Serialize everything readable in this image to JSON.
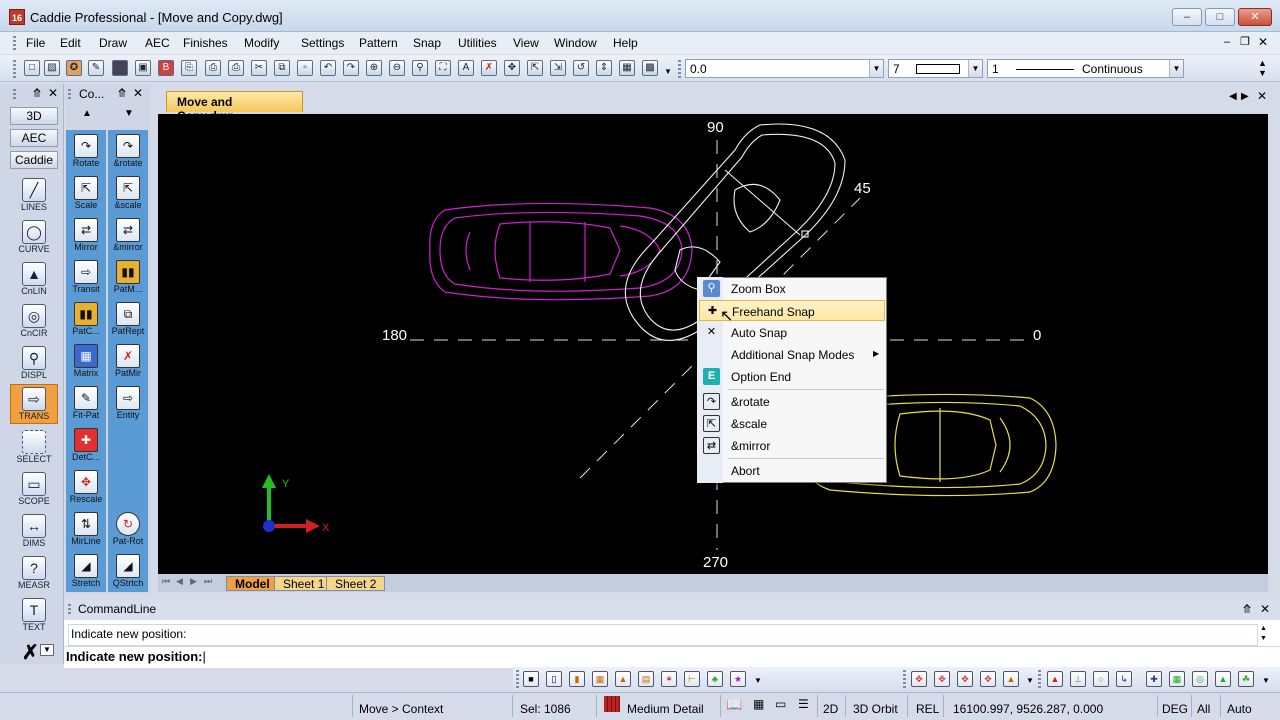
{
  "window": {
    "title": "Caddie Professional - [Move and Copy.dwg]",
    "icon_label": "16"
  },
  "menu": [
    "File",
    "Edit",
    "Draw",
    "AEC",
    "Finishes",
    "Modify",
    "Settings",
    "Pattern",
    "Snap",
    "Utilities",
    "View",
    "Window",
    "Help"
  ],
  "toolbar": {
    "coord_value": "0.0",
    "color_value": "7",
    "linetype_scale": "1",
    "linetype_name": "Continuous"
  },
  "left_panel": {
    "tabs": [
      "3D",
      "AEC",
      "Caddie"
    ],
    "tools": [
      "LINES",
      "CURVE",
      "CnLIN",
      "CnCIR",
      "DISPL",
      "TRANS",
      "SELECT",
      "SCOPE",
      "DIMS",
      "MEASR",
      "TEXT"
    ]
  },
  "cmd_panel": {
    "title": "Co...",
    "left_tools": [
      "Rotate",
      "Scale",
      "Mirror",
      "Transit",
      "PatC...",
      "Matrix",
      "Fit-Pat",
      "DetC...",
      "Rescale",
      "MirLine",
      "Stretch"
    ],
    "right_tools": [
      "&rotate",
      "&scale",
      "&mirror",
      "PatM...",
      "PatRept",
      "PatMir",
      "Entity",
      "Pat-Rot",
      "QStrtch"
    ]
  },
  "document_tab": "Move and Copy.dwg",
  "canvas": {
    "angle_labels": {
      "top": "90",
      "right_top": "45",
      "left": "180",
      "right": "0",
      "bottom": "270"
    },
    "ucs": {
      "x_label": "X",
      "y_label": "Y"
    }
  },
  "sheet_tabs": [
    "Model",
    "Sheet 1",
    "Sheet 2"
  ],
  "context_menu": {
    "items": [
      "Zoom Box",
      "Freehand Snap",
      "Auto Snap",
      "Additional Snap Modes",
      "Option End",
      "&rotate",
      "&scale",
      "&mirror",
      "Abort"
    ],
    "highlighted": "Freehand Snap"
  },
  "commandline": {
    "title": "CommandLine",
    "history": "Indicate new position:",
    "prompt": "Indicate new position:"
  },
  "statusbar": {
    "context": "Move > Context",
    "selection": "Sel: 1086",
    "detail": "Medium Detail",
    "view_2d": "2D",
    "orbit": "3D Orbit",
    "rel": "REL",
    "coords": "16100.997, 9526.287, 0.000",
    "units": "DEG",
    "layers": "All",
    "auto": "Auto"
  }
}
